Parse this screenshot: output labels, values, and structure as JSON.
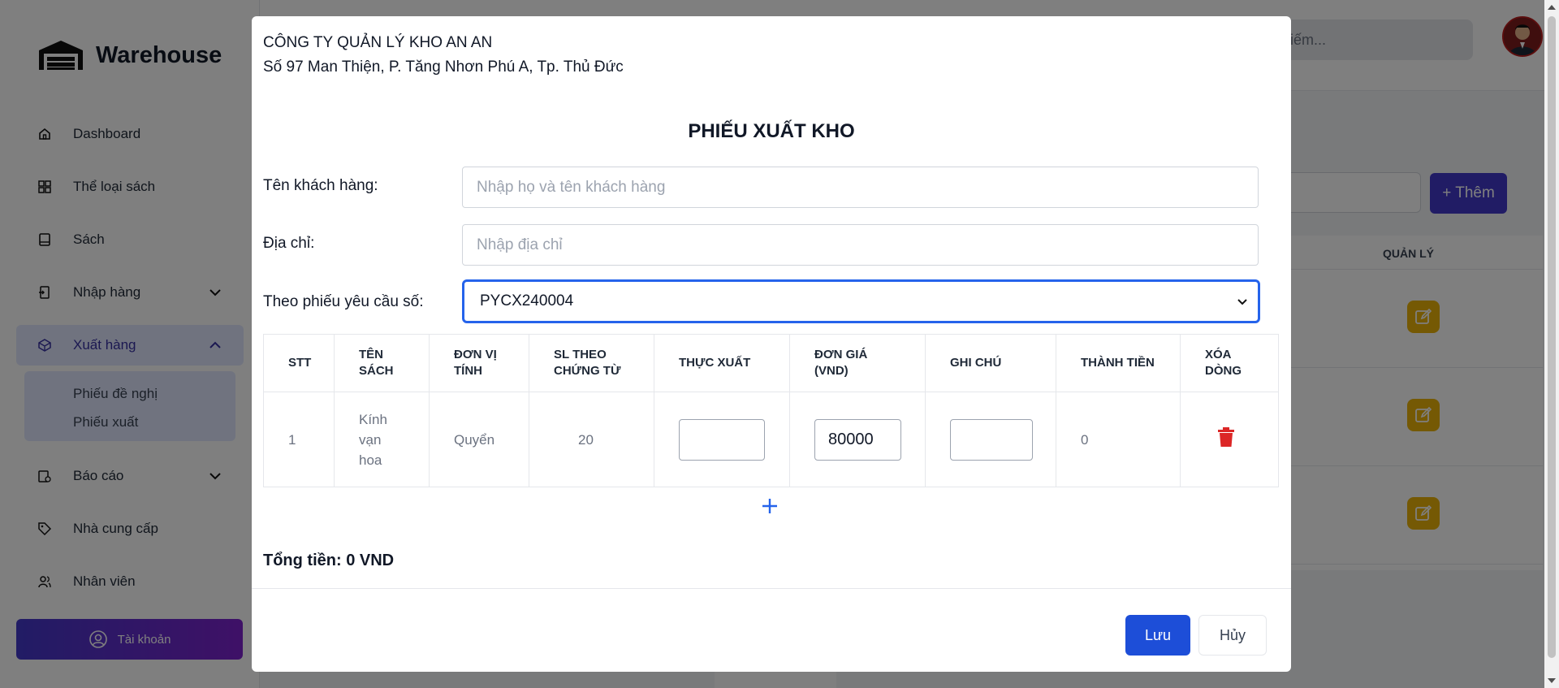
{
  "app": {
    "brand": "Warehouse",
    "sidebar": {
      "items": [
        {
          "label": "Dashboard",
          "icon": "home-icon"
        },
        {
          "label": "Thể loại sách",
          "icon": "grid-icon"
        },
        {
          "label": "Sách",
          "icon": "book-icon"
        },
        {
          "label": "Nhập hàng",
          "icon": "import-icon"
        },
        {
          "label": "Xuất hàng",
          "icon": "export-icon"
        },
        {
          "label": "Báo cáo",
          "icon": "report-icon"
        },
        {
          "label": "Nhà cung cấp",
          "icon": "tag-icon"
        },
        {
          "label": "Nhân viên",
          "icon": "users-icon"
        }
      ],
      "submenu": [
        "Phiếu đề nghị",
        "Phiếu xuất"
      ],
      "account_label": "Tài khoản"
    },
    "search_placeholder": "m kiếm...",
    "add_button_label": "+ Thêm",
    "table_header_manage": "QUẢN LÝ"
  },
  "modal": {
    "company_name": "CÔNG TY QUẢN LÝ KHO AN AN",
    "company_address": "Số 97 Man Thiện, P. Tăng Nhơn Phú A, Tp. Thủ Đức",
    "title": "PHIẾU XUẤT KHO",
    "customer_label": "Tên khách hàng:",
    "customer_placeholder": "Nhập họ và tên khách hàng",
    "address_label": "Địa chỉ:",
    "address_placeholder": "Nhập địa chỉ",
    "request_label": "Theo phiếu yêu cầu số:",
    "request_value": "PYCX240004",
    "table": {
      "headers": [
        "STT",
        "TÊN SÁCH",
        "ĐƠN VỊ TÍNH",
        "SL THEO CHỨNG TỪ",
        "THỰC XUẤT",
        "ĐƠN GIÁ (VND)",
        "GHI CHÚ",
        "THÀNH TIỀN",
        "XÓA DÒNG"
      ],
      "rows": [
        {
          "stt": "1",
          "book": "Kính vạn hoa",
          "unit": "Quyển",
          "doc_qty": "20",
          "actual_qty": "",
          "price": "80000",
          "note": "",
          "amount": "0"
        }
      ]
    },
    "total": "Tổng tiền: 0 VND",
    "save_label": "Lưu",
    "cancel_label": "Hủy"
  },
  "colors": {
    "primary": "#1d4ed8",
    "accent": "#4338ca",
    "delete": "#dc2626",
    "edit": "#eab308"
  }
}
